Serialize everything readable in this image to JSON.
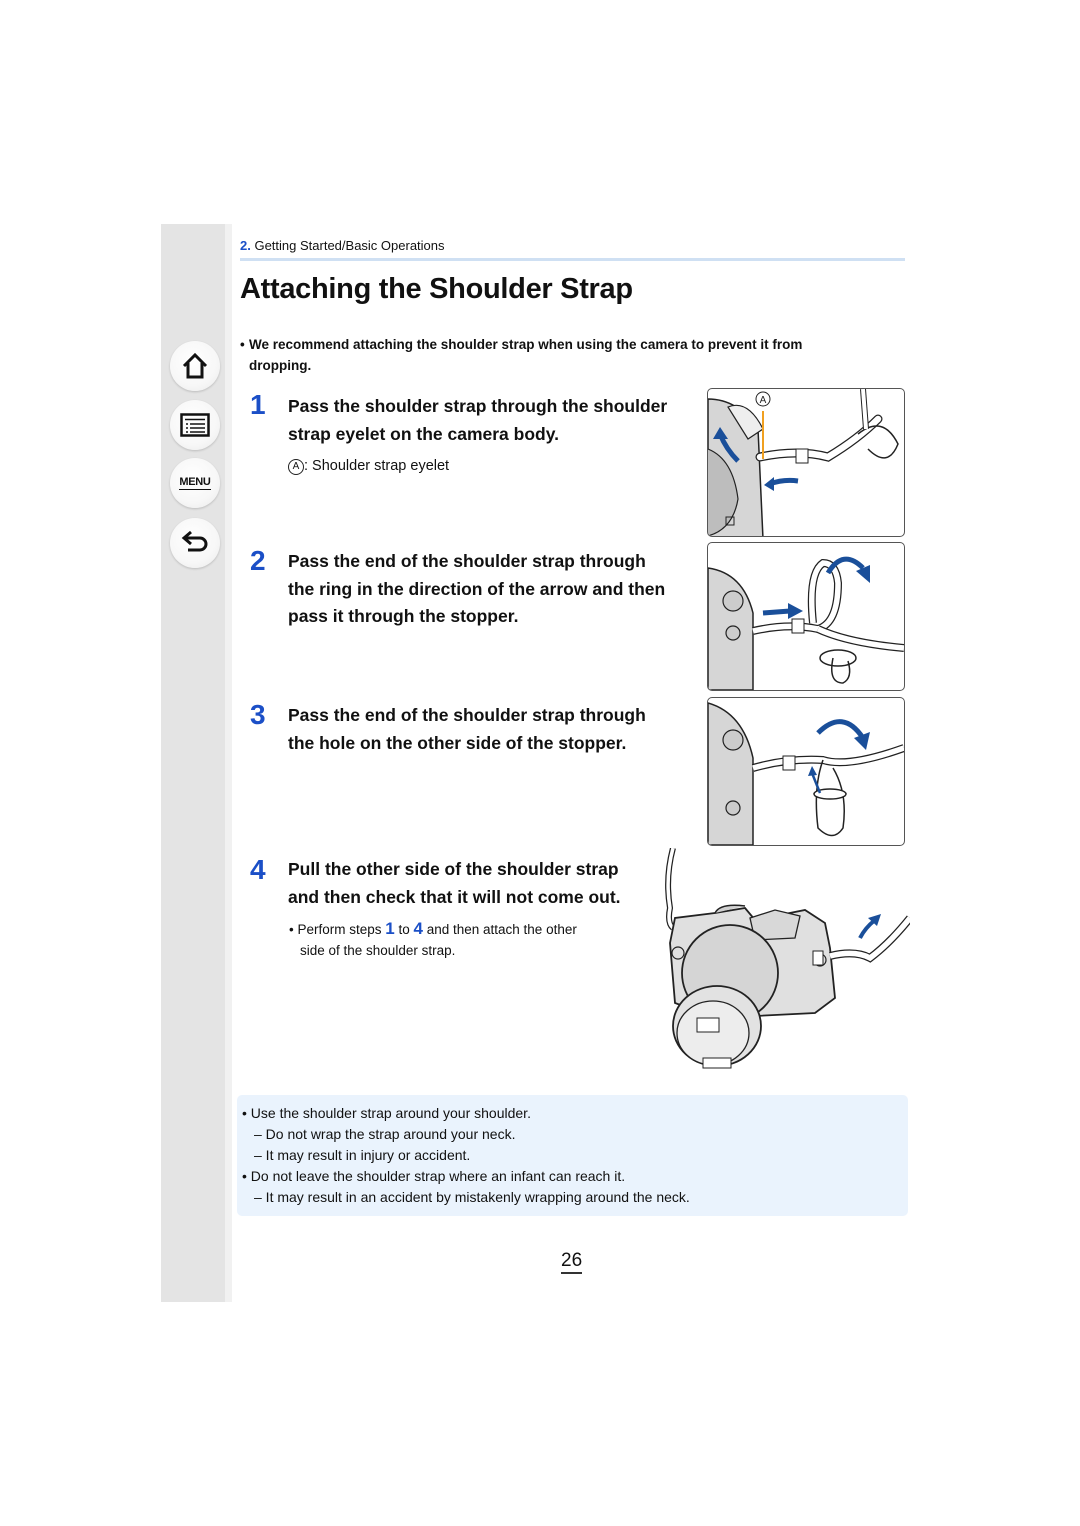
{
  "nav": {
    "items": [
      {
        "name": "home",
        "icon": "home-icon"
      },
      {
        "name": "contents",
        "icon": "list-icon"
      },
      {
        "name": "menu",
        "icon": "menu-icon",
        "label": "MENU"
      },
      {
        "name": "back",
        "icon": "back-arrow-icon"
      }
    ]
  },
  "header": {
    "chapter_number": "2.",
    "chapter_title": "Getting Started/Basic Operations",
    "rule_color": "#cfe0f3"
  },
  "page_title": "Attaching the Shoulder Strap",
  "intro": {
    "bullet": "•",
    "line1": "We recommend attaching the shoulder strap when using the camera to prevent it from",
    "line2": "dropping."
  },
  "accent_color": "#1b4fc7",
  "steps": [
    {
      "number": "1",
      "lines": [
        "Pass the shoulder strap through the shoulder",
        "strap eyelet on the camera body."
      ],
      "note_marker": "A",
      "note_text": ": Shoulder strap eyelet"
    },
    {
      "number": "2",
      "lines": [
        "Pass the end of the shoulder strap through",
        "the ring in the direction of the arrow and then",
        "pass it through the stopper."
      ]
    },
    {
      "number": "3",
      "lines": [
        "Pass the end of the shoulder strap through",
        "the hole on the other side of the stopper."
      ]
    },
    {
      "number": "4",
      "lines": [
        "Pull the other side of the shoulder strap",
        "and then check that it will not come out."
      ],
      "note": {
        "prefix": "• Perform steps ",
        "from": "1",
        "mid": " to ",
        "to": "4",
        "suffix": " and then attach the other",
        "line2": "side of the shoulder strap."
      }
    }
  ],
  "illustrations": {
    "step1_marker": "A"
  },
  "caution": {
    "background": "#eaf3fd",
    "lines": [
      "• Use the shoulder strap around your shoulder.",
      "– Do not wrap the strap around your neck.",
      "– It may result in injury or accident.",
      "• Do not leave the shoulder strap where an infant can reach it.",
      "– It may result in an accident by mistakenly wrapping around the neck."
    ]
  },
  "page_number": "26"
}
